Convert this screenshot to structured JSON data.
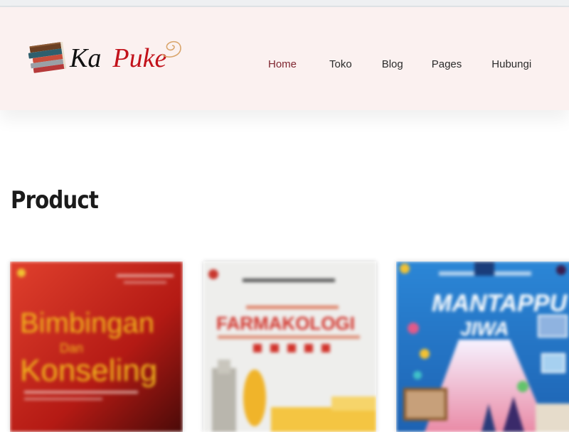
{
  "header": {
    "logo": {
      "text_1": "Ka",
      "text_2": "Puke"
    },
    "nav": [
      {
        "label": "Home",
        "active": true
      },
      {
        "label": "Toko",
        "active": false
      },
      {
        "label": "Blog",
        "active": false
      },
      {
        "label": "Pages",
        "active": false
      },
      {
        "label": "Hubungi",
        "active": false
      }
    ]
  },
  "main": {
    "section_title": "Product",
    "products": [
      {
        "cover_title": "Bimbingan dan Konseling"
      },
      {
        "cover_title": "FARMAKOLOGI"
      },
      {
        "cover_title": "MANTAPPU"
      }
    ]
  },
  "colors": {
    "header_bg": "#fbf1f0",
    "nav_active": "#7f2630",
    "logo_red": "#c2121b"
  }
}
